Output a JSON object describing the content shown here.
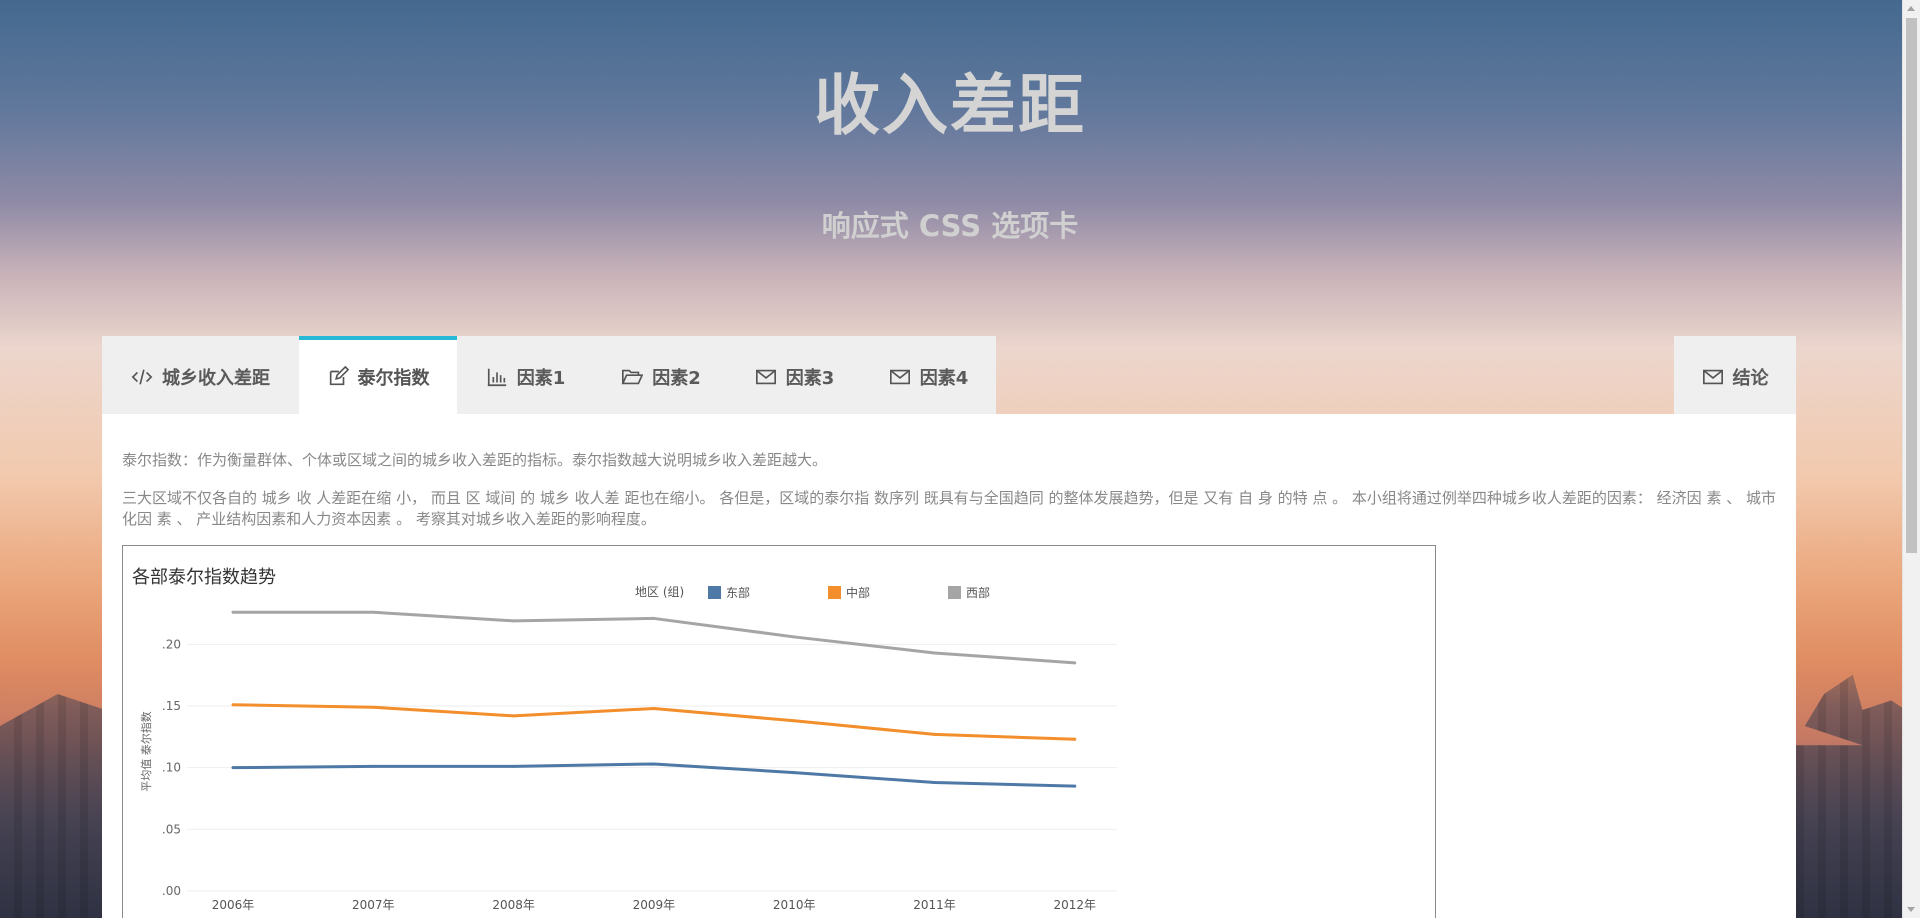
{
  "hero": {
    "title": "收入差距",
    "subtitle": "响应式 CSS 选项卡"
  },
  "tabs": [
    {
      "label": "城乡收入差距",
      "icon": "code-icon",
      "active": false
    },
    {
      "label": "泰尔指数",
      "icon": "edit-icon",
      "active": true
    },
    {
      "label": "因素1",
      "icon": "bar-chart-icon",
      "active": false
    },
    {
      "label": "因素2",
      "icon": "folder-open-icon",
      "active": false
    },
    {
      "label": "因素3",
      "icon": "envelope-icon",
      "active": false
    },
    {
      "label": "因素4",
      "icon": "envelope-icon",
      "active": false
    }
  ],
  "conclusion_tab": {
    "label": "结论",
    "icon": "envelope-icon"
  },
  "content": {
    "para1": "泰尔指数：作为衡量群体、个体或区域之间的城乡收入差距的指标。泰尔指数越大说明城乡收入差距越大。",
    "para2": "三大区域不仅各自的 城乡 收 人差距在缩 小， 而且 区 域间 的 城乡 收人差 距也在缩小。 各但是，区域的泰尔指 数序列 既具有与全国趋同 的整体发展趋势，但是 又有 自 身 的特 点 。 本小组将通过例举四种城乡收人差距的因素： 经济因 素 、 城市化因 素 、 产业结构因素和人力资本因素 。 考察其对城乡收入差距的影响程度。"
  },
  "chart_data": {
    "type": "line",
    "title": "各部泰尔指数趋势",
    "xlabel": "",
    "ylabel": "平均值 泰尔指数",
    "legend_title": "地区 (组)",
    "legend_position": "top",
    "x": [
      "2006年",
      "2007年",
      "2008年",
      "2009年",
      "2010年",
      "2011年",
      "2012年"
    ],
    "yticks": [
      ".00",
      ".05",
      ".10",
      ".15",
      ".20"
    ],
    "ylim": [
      0,
      0.21
    ],
    "grid": true,
    "series": [
      {
        "name": "东部",
        "color": "#4e79a7",
        "values": [
          0.1,
          0.101,
          0.101,
          0.103,
          0.096,
          0.088,
          0.085
        ]
      },
      {
        "name": "中部",
        "color": "#f28e2b",
        "values": [
          0.151,
          0.149,
          0.142,
          0.148,
          0.138,
          0.127,
          0.123
        ]
      },
      {
        "name": "西部",
        "color": "#a5a5a5",
        "values": [
          0.226,
          0.226,
          0.219,
          0.221,
          0.206,
          0.193,
          0.185
        ]
      }
    ]
  }
}
